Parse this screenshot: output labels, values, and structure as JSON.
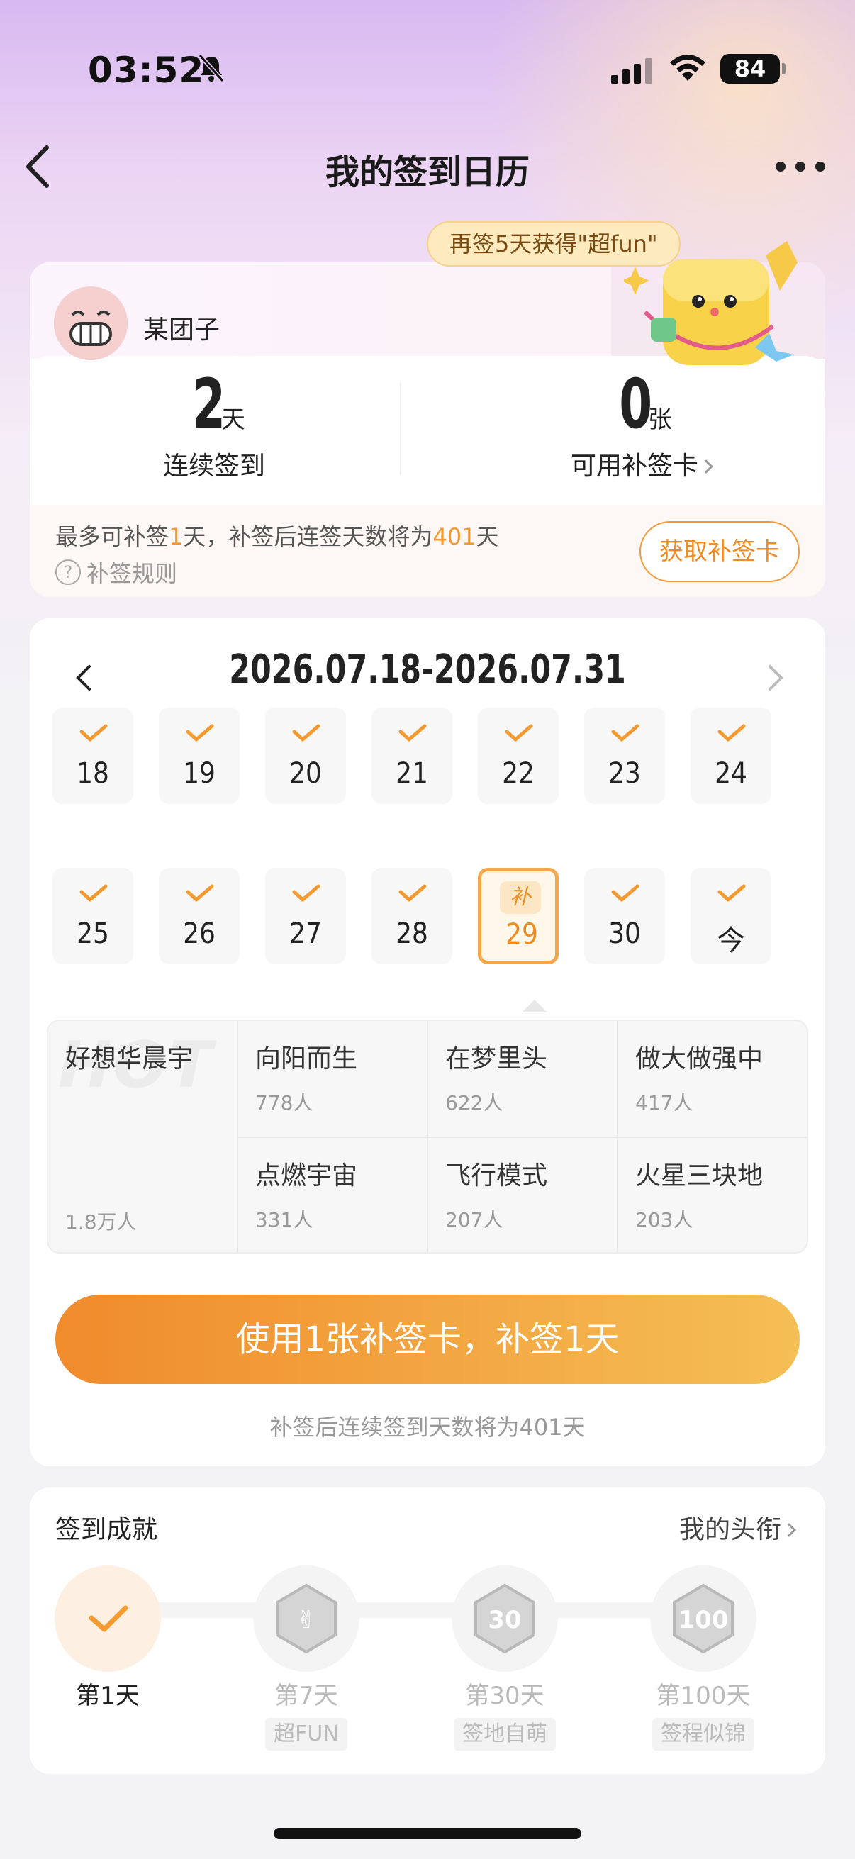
{
  "status_bar": {
    "time": "03:52",
    "battery": "84"
  },
  "nav": {
    "title": "我的签到日历"
  },
  "promo": {
    "text": "再签5天获得\"超fun\""
  },
  "user": {
    "name": "某团子",
    "streak_value": "2",
    "streak_unit": "天",
    "streak_label": "连续签到",
    "cards_value": "0",
    "cards_unit": "张",
    "cards_label": "可用补签卡",
    "note_prefix": "最多可补签",
    "note_days": "1",
    "note_mid": "天，补签后连签天数将为",
    "note_total": "401",
    "note_suffix": "天",
    "rules_label": "补签规则",
    "get_card_button": "获取补签卡"
  },
  "calendar": {
    "range": "2026.07.18-2026.07.31",
    "row1": [
      {
        "label": "18",
        "status": "checked"
      },
      {
        "label": "19",
        "status": "checked"
      },
      {
        "label": "20",
        "status": "checked"
      },
      {
        "label": "21",
        "status": "checked"
      },
      {
        "label": "22",
        "status": "checked"
      },
      {
        "label": "23",
        "status": "checked"
      },
      {
        "label": "24",
        "status": "checked"
      }
    ],
    "row2": [
      {
        "label": "25",
        "status": "checked"
      },
      {
        "label": "26",
        "status": "checked"
      },
      {
        "label": "27",
        "status": "checked"
      },
      {
        "label": "28",
        "status": "checked"
      },
      {
        "label": "29",
        "status": "makeup",
        "tag": "补"
      },
      {
        "label": "30",
        "status": "checked"
      },
      {
        "label": "今",
        "status": "checked"
      }
    ],
    "ranking": {
      "first": {
        "name": "好想华晨宇",
        "count": "1.8万人",
        "watermark": "HOT"
      },
      "others": [
        {
          "name": "向阳而生",
          "count": "778人"
        },
        {
          "name": "在梦里头",
          "count": "622人"
        },
        {
          "name": "做大做强中",
          "count": "417人"
        },
        {
          "name": "点燃宇宙",
          "count": "331人"
        },
        {
          "name": "飞行模式",
          "count": "207人"
        },
        {
          "name": "火星三块地",
          "count": "203人"
        }
      ]
    },
    "primary_button": "使用1张补签卡，补签1天",
    "button_note": "补签后连续签到天数将为401天"
  },
  "achievements": {
    "title": "签到成就",
    "link": "我的头衔",
    "items": [
      {
        "day": "第1天",
        "tag": "",
        "done": true
      },
      {
        "day": "第7天",
        "tag": "超FUN",
        "done": false
      },
      {
        "day": "第30天",
        "tag": "签地自萌",
        "done": false
      },
      {
        "day": "第100天",
        "tag": "签程似锦",
        "done": false
      }
    ]
  },
  "colors": {
    "accent": "#f39a31",
    "button_start": "#f08b2c",
    "button_end": "#f5bf55"
  }
}
